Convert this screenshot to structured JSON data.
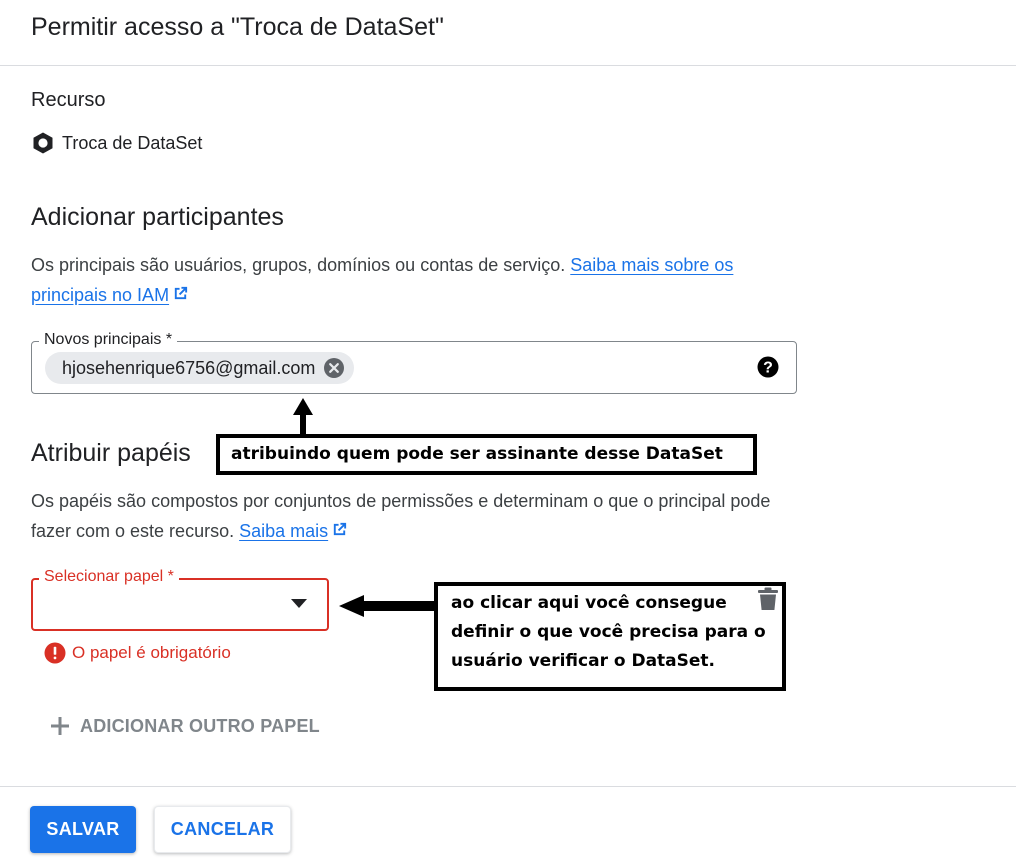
{
  "dialog": {
    "title": "Permitir acesso a \"Troca de DataSet\""
  },
  "resource": {
    "label": "Recurso",
    "name": "Troca de DataSet",
    "icon": "bigquery-hexagon-icon"
  },
  "add_members": {
    "title": "Adicionar participantes",
    "description": "Os principais são usuários, grupos, domínios ou contas de serviço. ",
    "link_text": "Saiba mais sobre os principais no IAM",
    "field_label": "Novos principais *",
    "chip_value": "hjosehenrique6756@gmail.com"
  },
  "assign_roles": {
    "title": "Atribuir papéis",
    "description": "Os papéis são compostos por conjuntos de permissões e determinam o que o principal pode fazer com o este recurso. ",
    "link_text": "Saiba mais",
    "select_label": "Selecionar papel *",
    "selected_value": "",
    "error_text": "O papel é obrigatório",
    "add_role_label": "ADICIONAR OUTRO PAPEL"
  },
  "annotations": {
    "principals_note": "atribuindo quem pode ser assinante desse DataSet",
    "role_note": "ao clicar aqui você consegue definir o que você precisa para o usuário verificar o DataSet."
  },
  "buttons": {
    "save": "SALVAR",
    "cancel": "CANCELAR"
  },
  "colors": {
    "primary": "#1a73e8",
    "error": "#d93025",
    "text": "#202124",
    "muted": "#80868b"
  }
}
